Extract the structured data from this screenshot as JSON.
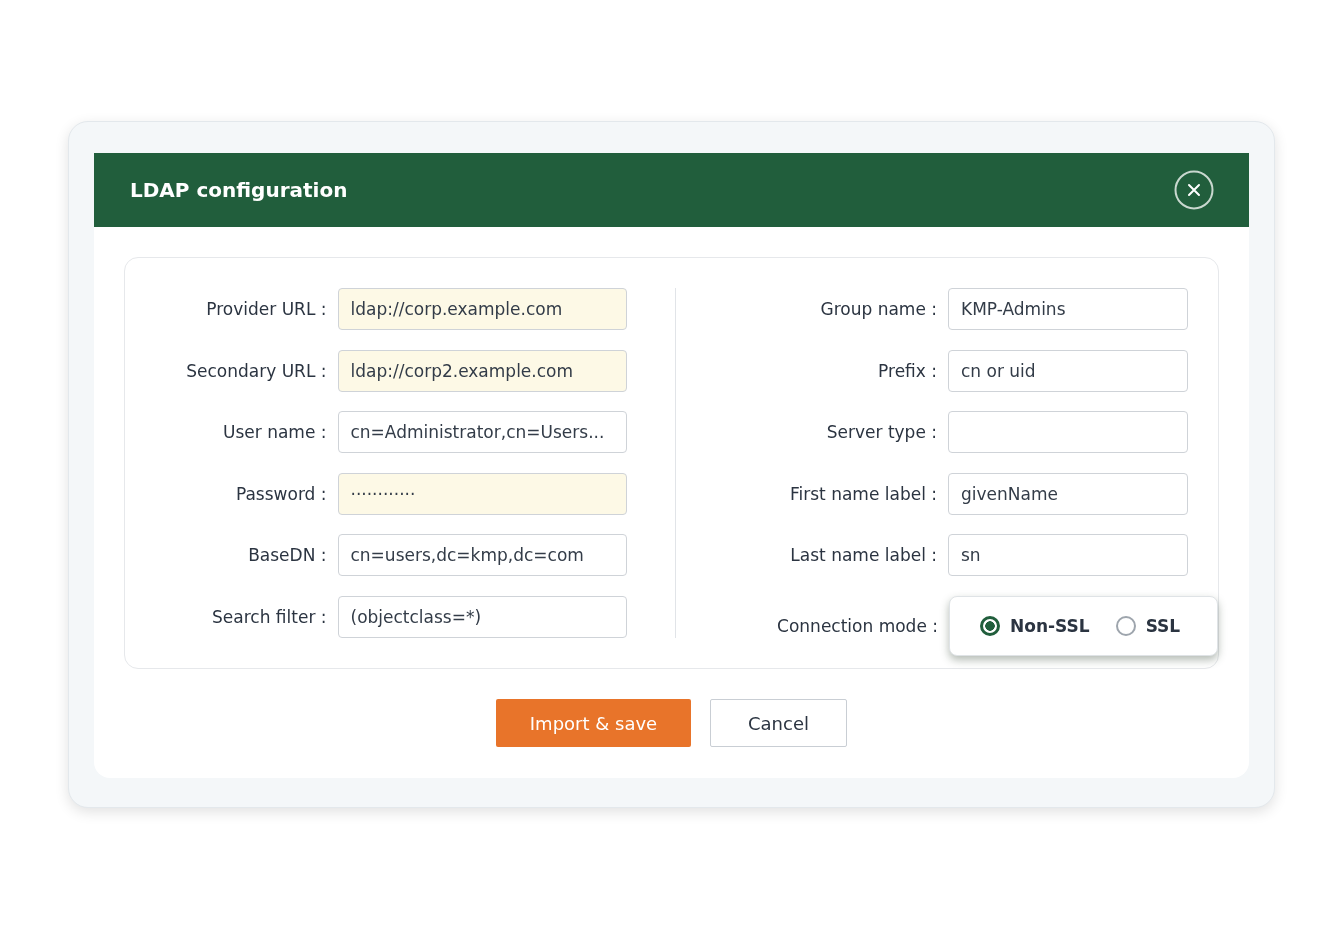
{
  "dialog": {
    "title": "LDAP configuration"
  },
  "left_fields": [
    {
      "label": "Provider URL :",
      "value": "ldap://corp.example.com",
      "autofilled": true
    },
    {
      "label": "Secondary URL :",
      "value": "ldap://corp2.example.com",
      "autofilled": true
    },
    {
      "label": "User name :",
      "value": "cn=Administrator,cn=Users...",
      "autofilled": false
    },
    {
      "label": "Password :",
      "value": "············",
      "autofilled": true
    },
    {
      "label": "BaseDN :",
      "value": "cn=users,dc=kmp,dc=com",
      "autofilled": false
    },
    {
      "label": "Search filter :",
      "value": "(objectclass=*)",
      "autofilled": false
    }
  ],
  "right_fields": [
    {
      "label": "Group name :",
      "value": "KMP-Admins",
      "autofilled": false
    },
    {
      "label": "Prefix :",
      "value": "cn or uid",
      "autofilled": false
    },
    {
      "label": "Server type :",
      "autofilled": false
    },
    {
      "label": "First name label :",
      "value": "givenName",
      "autofilled": false
    },
    {
      "label": "Last name label :",
      "value": "sn",
      "autofilled": false
    }
  ],
  "connection_mode": {
    "label": "Connection mode :",
    "options": [
      {
        "label": "Non-SSL",
        "selected": true
      },
      {
        "label": "SSL",
        "selected": false
      }
    ]
  },
  "buttons": [
    {
      "label": "Import & save",
      "kind": "primary"
    },
    {
      "label": "Cancel",
      "kind": "secondary"
    }
  ]
}
